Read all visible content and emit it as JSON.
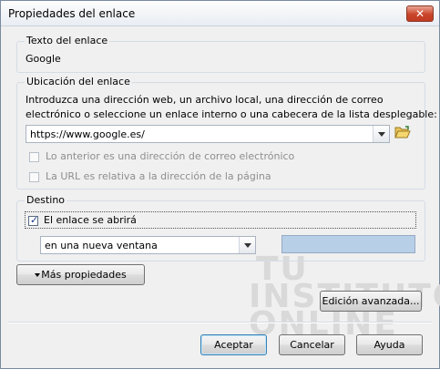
{
  "window": {
    "title": "Propiedades del enlace"
  },
  "link_text": {
    "legend": "Texto del enlace",
    "value": "Google"
  },
  "location": {
    "legend": "Ubicación del enlace",
    "description_line1": "Introduzca una dirección web, un archivo local, una dirección de correo",
    "description_line2": "electrónico o seleccione un enlace interno o una cabecera de la lista desplegable:",
    "url_value": "https://www.google.es/",
    "email_checkbox_label": "Lo anterior es una dirección de correo electrónico",
    "relative_checkbox_label": "La URL es relativa a la dirección de la página"
  },
  "target": {
    "legend": "Destino",
    "open_checkbox_label": "El enlace se abrirá",
    "open_checked": true,
    "window_option": "en una nueva ventana"
  },
  "buttons": {
    "more_properties": "Más propiedades",
    "advanced_edit": "Edición avanzada...",
    "accept": "Aceptar",
    "cancel": "Cancelar",
    "help": "Ayuda"
  },
  "watermark": {
    "line1": "TU",
    "line2": "INSTITUTO",
    "line3": "ONLINE"
  },
  "colors": {
    "target_swatch": "#b8cfe8",
    "close_button": "#c9452b"
  }
}
